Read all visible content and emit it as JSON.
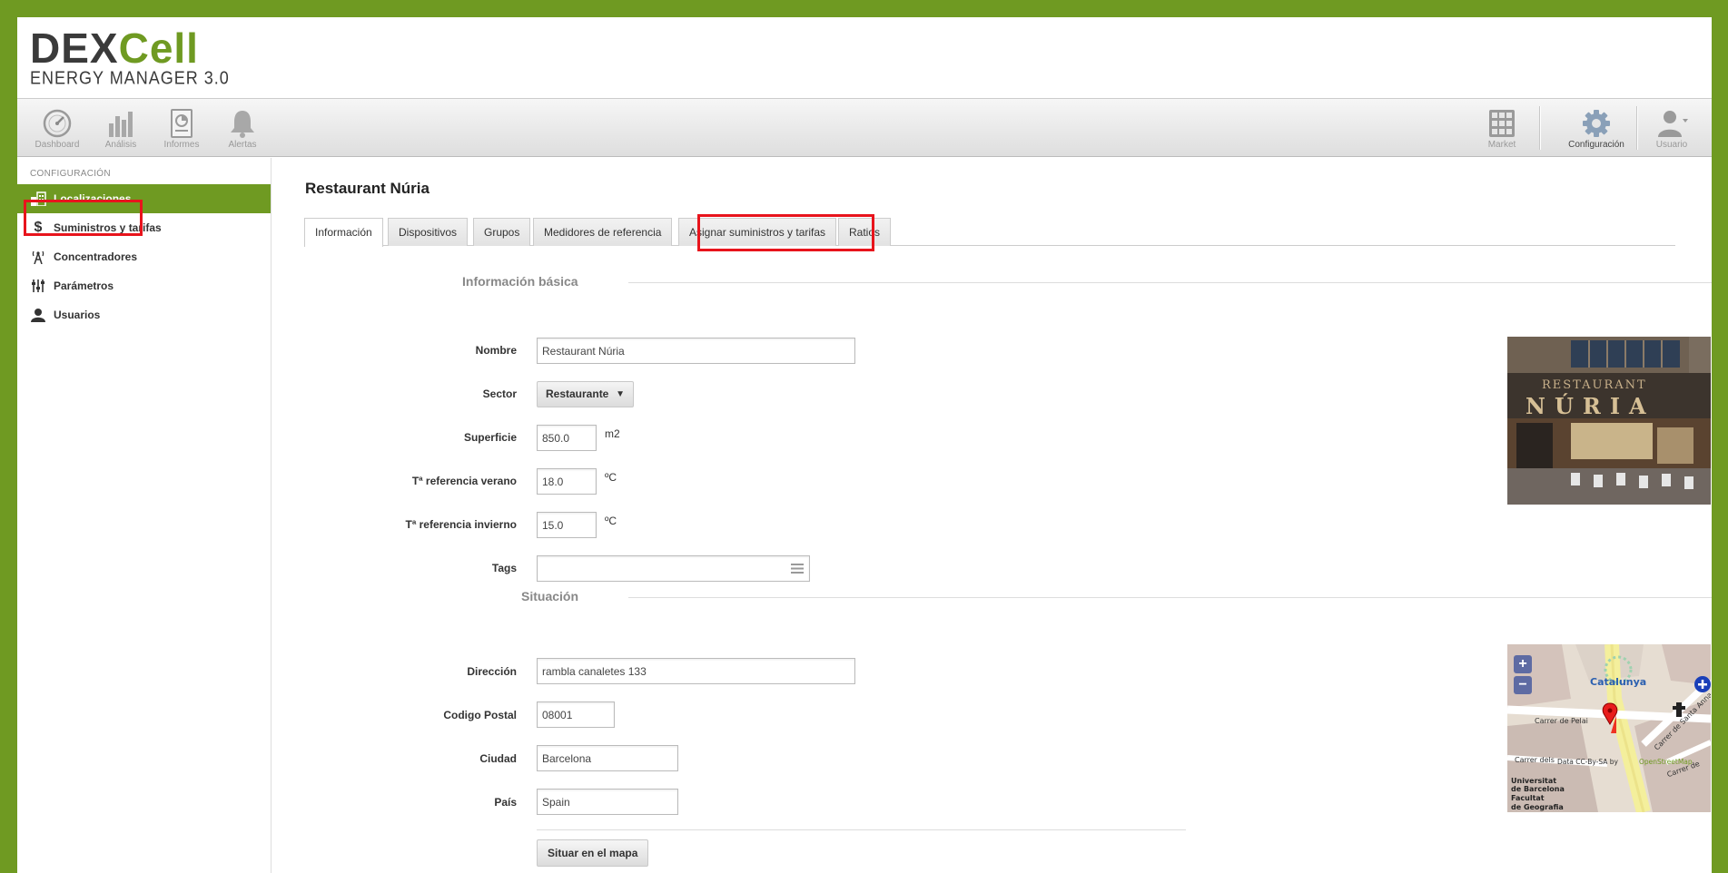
{
  "logo": {
    "brand_dark": "DEX",
    "brand_green": "Cell",
    "subtitle": "ENERGY MANAGER 3.0"
  },
  "toolbar": {
    "left": [
      {
        "label": "Dashboard",
        "icon": "gauge-icon"
      },
      {
        "label": "Análisis",
        "icon": "bar-chart-icon"
      },
      {
        "label": "Informes",
        "icon": "report-icon"
      },
      {
        "label": "Alertas",
        "icon": "bell-icon"
      }
    ],
    "right": [
      {
        "label": "Market",
        "icon": "grid-icon"
      },
      {
        "label": "Configuración",
        "icon": "gear-icon",
        "active": true
      },
      {
        "label": "Usuario",
        "icon": "user-icon"
      }
    ]
  },
  "sidebar": {
    "heading": "CONFIGURACIÓN",
    "items": [
      {
        "label": "Localizaciones",
        "icon": "buildings-icon",
        "active": true
      },
      {
        "label": "Suministros y tarifas",
        "icon": "dollar-icon"
      },
      {
        "label": "Concentradores",
        "icon": "antenna-icon"
      },
      {
        "label": "Parámetros",
        "icon": "sliders-icon"
      },
      {
        "label": "Usuarios",
        "icon": "user-icon"
      }
    ]
  },
  "page": {
    "title": "Restaurant Núria"
  },
  "tabs": [
    {
      "label": "Información",
      "active": true
    },
    {
      "label": "Dispositivos"
    },
    {
      "label": "Grupos"
    },
    {
      "label": "Medidores de referencia"
    },
    {
      "label": "Asignar suministros y tarifas"
    },
    {
      "label": "Ratios"
    }
  ],
  "basic": {
    "title": "Información básica",
    "nombre": {
      "label": "Nombre",
      "value": "Restaurant Núria"
    },
    "sector": {
      "label": "Sector",
      "value": "Restaurante",
      "arrow": "▼"
    },
    "superficie": {
      "label": "Superficie",
      "value": "850.0",
      "unit": "m2"
    },
    "t_verano": {
      "label": "Tª referencia verano",
      "value": "18.0",
      "unit": "ºC"
    },
    "t_invierno": {
      "label": "Tª referencia invierno",
      "value": "15.0",
      "unit": "ºC"
    },
    "tags": {
      "label": "Tags",
      "value": ""
    }
  },
  "location": {
    "title": "Situación",
    "direccion": {
      "label": "Dirección",
      "value": "rambla canaletes 133"
    },
    "cp": {
      "label": "Codigo Postal",
      "value": "08001"
    },
    "ciudad": {
      "label": "Ciudad",
      "value": "Barcelona"
    },
    "pais": {
      "label": "País",
      "value": "Spain"
    },
    "button": "Situar en el mapa"
  },
  "photo": {
    "sign_top": "RESTAURANT",
    "sign_main": "NÚRIA"
  },
  "map": {
    "zoom_in": "+",
    "zoom_out": "−",
    "place": "Catalunya",
    "street1": "Carrer de Pelai",
    "street2": "Carrer de Santa Anna",
    "street3": "Carrer dels",
    "street4": "Carrer de",
    "uni1": "Universitat",
    "uni2": "de Barcelona",
    "uni3": "Facultat",
    "uni4": "de Geografia",
    "attr_prefix": "Data CC-By-SA by",
    "attr_link": "OpenStreetMap"
  },
  "colors": {
    "accent": "#6f9a22",
    "highlight": "#e8141c"
  }
}
